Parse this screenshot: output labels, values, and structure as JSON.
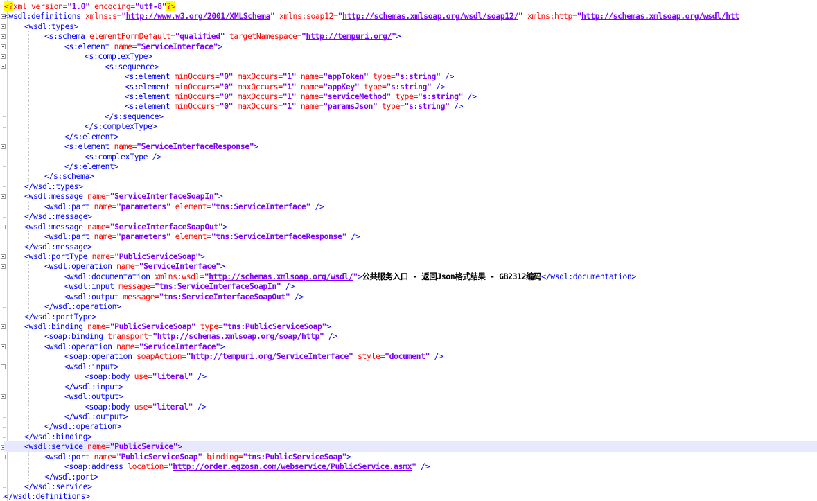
{
  "editor": {
    "current_line": 44,
    "lines": [
      {
        "i": 0,
        "t": [
          [
            "pi",
            "<?"
          ],
          [
            "pitext",
            "xml version="
          ],
          [
            "val",
            "\"1.0\""
          ],
          [
            "pitext",
            " encoding="
          ],
          [
            "val",
            "\"utf-8\""
          ],
          [
            "pi",
            "?>"
          ]
        ]
      },
      {
        "i": 0,
        "t": [
          [
            "tag",
            "<wsdl:definitions "
          ],
          [
            "attr",
            "xmlns:s="
          ],
          [
            "val",
            "\""
          ],
          [
            "url",
            "http://www.w3.org/2001/XMLSchema"
          ],
          [
            "val",
            "\""
          ],
          [
            "attr",
            " xmlns:soap12="
          ],
          [
            "val",
            "\""
          ],
          [
            "url",
            "http://schemas.xmlsoap.org/wsdl/soap12/"
          ],
          [
            "val",
            "\""
          ],
          [
            "attr",
            " xmlns:http="
          ],
          [
            "val",
            "\""
          ],
          [
            "url",
            "http://schemas.xmlsoap.org/wsdl/htt"
          ]
        ]
      },
      {
        "i": 1,
        "t": [
          [
            "tag",
            "<wsdl:types>"
          ]
        ]
      },
      {
        "i": 2,
        "t": [
          [
            "tag",
            "<s:schema "
          ],
          [
            "attr",
            "elementFormDefault="
          ],
          [
            "val",
            "\"qualified\""
          ],
          [
            "attr",
            " targetNamespace="
          ],
          [
            "val",
            "\""
          ],
          [
            "url",
            "http://tempuri.org/"
          ],
          [
            "val",
            "\""
          ],
          [
            "tag",
            ">"
          ]
        ]
      },
      {
        "i": 3,
        "t": [
          [
            "tag",
            "<s:element "
          ],
          [
            "attr",
            "name="
          ],
          [
            "val",
            "\"ServiceInterface\""
          ],
          [
            "tag",
            ">"
          ]
        ]
      },
      {
        "i": 4,
        "t": [
          [
            "tag",
            "<s:complexType>"
          ]
        ]
      },
      {
        "i": 5,
        "t": [
          [
            "tag",
            "<s:sequence>"
          ]
        ]
      },
      {
        "i": 6,
        "t": [
          [
            "tag",
            "<s:element "
          ],
          [
            "attr",
            "minOccurs="
          ],
          [
            "val",
            "\"0\""
          ],
          [
            "attr",
            " maxOccurs="
          ],
          [
            "val",
            "\"1\""
          ],
          [
            "attr",
            " name="
          ],
          [
            "val",
            "\"appToken\""
          ],
          [
            "attr",
            " type="
          ],
          [
            "val",
            "\"s:string\""
          ],
          [
            "tag",
            " />"
          ]
        ]
      },
      {
        "i": 6,
        "t": [
          [
            "tag",
            "<s:element "
          ],
          [
            "attr",
            "minOccurs="
          ],
          [
            "val",
            "\"0\""
          ],
          [
            "attr",
            " maxOccurs="
          ],
          [
            "val",
            "\"1\""
          ],
          [
            "attr",
            " name="
          ],
          [
            "val",
            "\"appKey\""
          ],
          [
            "attr",
            " type="
          ],
          [
            "val",
            "\"s:string\""
          ],
          [
            "tag",
            " />"
          ]
        ]
      },
      {
        "i": 6,
        "t": [
          [
            "tag",
            "<s:element "
          ],
          [
            "attr",
            "minOccurs="
          ],
          [
            "val",
            "\"0\""
          ],
          [
            "attr",
            " maxOccurs="
          ],
          [
            "val",
            "\"1\""
          ],
          [
            "attr",
            " name="
          ],
          [
            "val",
            "\"serviceMethod\""
          ],
          [
            "attr",
            " type="
          ],
          [
            "val",
            "\"s:string\""
          ],
          [
            "tag",
            " />"
          ]
        ]
      },
      {
        "i": 6,
        "t": [
          [
            "tag",
            "<s:element "
          ],
          [
            "attr",
            "minOccurs="
          ],
          [
            "val",
            "\"0\""
          ],
          [
            "attr",
            " maxOccurs="
          ],
          [
            "val",
            "\"1\""
          ],
          [
            "attr",
            " name="
          ],
          [
            "val",
            "\"paramsJson\""
          ],
          [
            "attr",
            " type="
          ],
          [
            "val",
            "\"s:string\""
          ],
          [
            "tag",
            " />"
          ]
        ]
      },
      {
        "i": 5,
        "t": [
          [
            "tag",
            "</s:sequence>"
          ]
        ]
      },
      {
        "i": 4,
        "t": [
          [
            "tag",
            "</s:complexType>"
          ]
        ]
      },
      {
        "i": 3,
        "t": [
          [
            "tag",
            "</s:element>"
          ]
        ]
      },
      {
        "i": 3,
        "t": [
          [
            "tag",
            "<s:element "
          ],
          [
            "attr",
            "name="
          ],
          [
            "val",
            "\"ServiceInterfaceResponse\""
          ],
          [
            "tag",
            ">"
          ]
        ]
      },
      {
        "i": 4,
        "t": [
          [
            "tag",
            "<s:complexType />"
          ]
        ]
      },
      {
        "i": 3,
        "t": [
          [
            "tag",
            "</s:element>"
          ]
        ]
      },
      {
        "i": 2,
        "t": [
          [
            "tag",
            "</s:schema>"
          ]
        ]
      },
      {
        "i": 1,
        "t": [
          [
            "tag",
            "</wsdl:types>"
          ]
        ]
      },
      {
        "i": 1,
        "t": [
          [
            "tag",
            "<wsdl:message "
          ],
          [
            "attr",
            "name="
          ],
          [
            "val",
            "\"ServiceInterfaceSoapIn\""
          ],
          [
            "tag",
            ">"
          ]
        ]
      },
      {
        "i": 2,
        "t": [
          [
            "tag",
            "<wsdl:part "
          ],
          [
            "attr",
            "name="
          ],
          [
            "val",
            "\"parameters\""
          ],
          [
            "attr",
            " element="
          ],
          [
            "val",
            "\"tns:ServiceInterface\""
          ],
          [
            "tag",
            " />"
          ]
        ]
      },
      {
        "i": 1,
        "t": [
          [
            "tag",
            "</wsdl:message>"
          ]
        ]
      },
      {
        "i": 1,
        "t": [
          [
            "tag",
            "<wsdl:message "
          ],
          [
            "attr",
            "name="
          ],
          [
            "val",
            "\"ServiceInterfaceSoapOut\""
          ],
          [
            "tag",
            ">"
          ]
        ]
      },
      {
        "i": 2,
        "t": [
          [
            "tag",
            "<wsdl:part "
          ],
          [
            "attr",
            "name="
          ],
          [
            "val",
            "\"parameters\""
          ],
          [
            "attr",
            " element="
          ],
          [
            "val",
            "\"tns:ServiceInterfaceResponse\""
          ],
          [
            "tag",
            " />"
          ]
        ]
      },
      {
        "i": 1,
        "t": [
          [
            "tag",
            "</wsdl:message>"
          ]
        ]
      },
      {
        "i": 1,
        "t": [
          [
            "tag",
            "<wsdl:portType "
          ],
          [
            "attr",
            "name="
          ],
          [
            "val",
            "\"PublicServiceSoap\""
          ],
          [
            "tag",
            ">"
          ]
        ]
      },
      {
        "i": 2,
        "t": [
          [
            "tag",
            "<wsdl:operation "
          ],
          [
            "attr",
            "name="
          ],
          [
            "val",
            "\"ServiceInterface\""
          ],
          [
            "tag",
            ">"
          ]
        ]
      },
      {
        "i": 3,
        "t": [
          [
            "tag",
            "<wsdl:documentation "
          ],
          [
            "attr",
            "xmlns:wsdl="
          ],
          [
            "val",
            "\""
          ],
          [
            "url",
            "http://schemas.xmlsoap.org/wsdl/"
          ],
          [
            "val",
            "\""
          ],
          [
            "tag",
            ">"
          ],
          [
            "text",
            "公共服务入口 - 返回Json格式结果 - GB2312编码"
          ],
          [
            "tag",
            "</wsdl:documentation>"
          ]
        ]
      },
      {
        "i": 3,
        "t": [
          [
            "tag",
            "<wsdl:input "
          ],
          [
            "attr",
            "message="
          ],
          [
            "val",
            "\"tns:ServiceInterfaceSoapIn\""
          ],
          [
            "tag",
            " />"
          ]
        ]
      },
      {
        "i": 3,
        "t": [
          [
            "tag",
            "<wsdl:output "
          ],
          [
            "attr",
            "message="
          ],
          [
            "val",
            "\"tns:ServiceInterfaceSoapOut\""
          ],
          [
            "tag",
            " />"
          ]
        ]
      },
      {
        "i": 2,
        "t": [
          [
            "tag",
            "</wsdl:operation>"
          ]
        ]
      },
      {
        "i": 1,
        "t": [
          [
            "tag",
            "</wsdl:portType>"
          ]
        ]
      },
      {
        "i": 1,
        "t": [
          [
            "tag",
            "<wsdl:binding "
          ],
          [
            "attr",
            "name="
          ],
          [
            "val",
            "\"PublicServiceSoap\""
          ],
          [
            "attr",
            " type="
          ],
          [
            "val",
            "\"tns:PublicServiceSoap\""
          ],
          [
            "tag",
            ">"
          ]
        ]
      },
      {
        "i": 2,
        "t": [
          [
            "tag",
            "<soap:binding "
          ],
          [
            "attr",
            "transport="
          ],
          [
            "val",
            "\""
          ],
          [
            "url",
            "http://schemas.xmlsoap.org/soap/http"
          ],
          [
            "val",
            "\""
          ],
          [
            "tag",
            " />"
          ]
        ]
      },
      {
        "i": 2,
        "t": [
          [
            "tag",
            "<wsdl:operation "
          ],
          [
            "attr",
            "name="
          ],
          [
            "val",
            "\"ServiceInterface\""
          ],
          [
            "tag",
            ">"
          ]
        ]
      },
      {
        "i": 3,
        "t": [
          [
            "tag",
            "<soap:operation "
          ],
          [
            "attr",
            "soapAction="
          ],
          [
            "val",
            "\""
          ],
          [
            "url",
            "http://tempuri.org/ServiceInterface"
          ],
          [
            "val",
            "\""
          ],
          [
            "attr",
            " style="
          ],
          [
            "val",
            "\"document\""
          ],
          [
            "tag",
            " />"
          ]
        ]
      },
      {
        "i": 3,
        "t": [
          [
            "tag",
            "<wsdl:input>"
          ]
        ]
      },
      {
        "i": 4,
        "t": [
          [
            "tag",
            "<soap:body "
          ],
          [
            "attr",
            "use="
          ],
          [
            "val",
            "\"literal\""
          ],
          [
            "tag",
            " />"
          ]
        ]
      },
      {
        "i": 3,
        "t": [
          [
            "tag",
            "</wsdl:input>"
          ]
        ]
      },
      {
        "i": 3,
        "t": [
          [
            "tag",
            "<wsdl:output>"
          ]
        ]
      },
      {
        "i": 4,
        "t": [
          [
            "tag",
            "<soap:body "
          ],
          [
            "attr",
            "use="
          ],
          [
            "val",
            "\"literal\""
          ],
          [
            "tag",
            " />"
          ]
        ]
      },
      {
        "i": 3,
        "t": [
          [
            "tag",
            "</wsdl:output>"
          ]
        ]
      },
      {
        "i": 2,
        "t": [
          [
            "tag",
            "</wsdl:operation>"
          ]
        ]
      },
      {
        "i": 1,
        "t": [
          [
            "tag",
            "</wsdl:binding>"
          ]
        ]
      },
      {
        "i": 1,
        "t": [
          [
            "tag",
            "<wsdl:service "
          ],
          [
            "attr",
            "name="
          ],
          [
            "val",
            "\"PublicService\""
          ],
          [
            "tag",
            ">"
          ]
        ]
      },
      {
        "i": 2,
        "t": [
          [
            "tag",
            "<wsdl:port "
          ],
          [
            "attr",
            "name="
          ],
          [
            "val",
            "\"PublicServiceSoap\""
          ],
          [
            "attr",
            " binding="
          ],
          [
            "val",
            "\"tns:PublicServiceSoap\""
          ],
          [
            "tag",
            ">"
          ]
        ]
      },
      {
        "i": 3,
        "t": [
          [
            "tag",
            "<soap:address "
          ],
          [
            "attr",
            "location="
          ],
          [
            "val",
            "\""
          ],
          [
            "url",
            "http://order.egzosn.com/webservice/PublicService.asmx"
          ],
          [
            "val",
            "\""
          ],
          [
            "tag",
            " />"
          ]
        ]
      },
      {
        "i": 2,
        "t": [
          [
            "tag",
            "</wsdl:port>"
          ]
        ]
      },
      {
        "i": 1,
        "t": [
          [
            "tag",
            "</wsdl:service>"
          ]
        ]
      },
      {
        "i": 0,
        "t": [
          [
            "tag",
            "</wsdl:definitions>"
          ]
        ]
      }
    ]
  }
}
